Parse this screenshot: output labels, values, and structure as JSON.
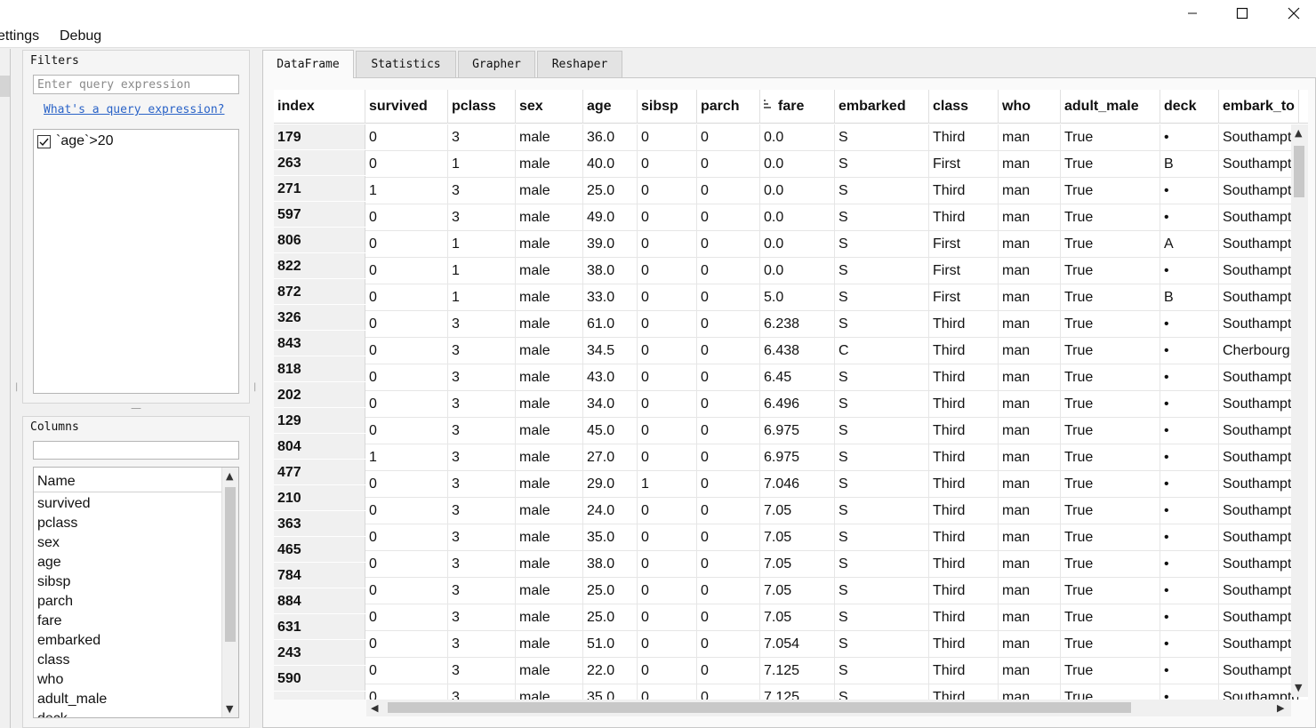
{
  "menu": {
    "settings": "ettings",
    "debug": "Debug"
  },
  "filters": {
    "title": "Filters",
    "placeholder": "Enter query expression",
    "help_link": "What's a query expression?",
    "items": [
      {
        "label": "`age`>20",
        "checked": true
      }
    ]
  },
  "columns_panel": {
    "title": "Columns",
    "header": "Name",
    "names": [
      "survived",
      "pclass",
      "sex",
      "age",
      "sibsp",
      "parch",
      "fare",
      "embarked",
      "class",
      "who",
      "adult_male",
      "deck"
    ]
  },
  "tabs": [
    "DataFrame",
    "Statistics",
    "Grapher",
    "Reshaper"
  ],
  "active_tab": "DataFrame",
  "table": {
    "index_header": "index",
    "headers": [
      "survived",
      "pclass",
      "sex",
      "age",
      "sibsp",
      "parch",
      "fare",
      "embarked",
      "class",
      "who",
      "adult_male",
      "deck",
      "embark_to"
    ],
    "sorted_column": "fare",
    "index": [
      "179",
      "263",
      "271",
      "597",
      "806",
      "822",
      "872",
      "326",
      "843",
      "818",
      "202",
      "129",
      "804",
      "477",
      "210",
      "363",
      "465",
      "784",
      "884",
      "631",
      "243",
      "590",
      ""
    ],
    "rows": [
      [
        "0",
        "3",
        "male",
        "36.0",
        "0",
        "0",
        "0.0",
        "S",
        "Third",
        "man",
        "True",
        "•",
        "Southampton"
      ],
      [
        "0",
        "1",
        "male",
        "40.0",
        "0",
        "0",
        "0.0",
        "S",
        "First",
        "man",
        "True",
        "B",
        "Southampton"
      ],
      [
        "1",
        "3",
        "male",
        "25.0",
        "0",
        "0",
        "0.0",
        "S",
        "Third",
        "man",
        "True",
        "•",
        "Southampton"
      ],
      [
        "0",
        "3",
        "male",
        "49.0",
        "0",
        "0",
        "0.0",
        "S",
        "Third",
        "man",
        "True",
        "•",
        "Southampton"
      ],
      [
        "0",
        "1",
        "male",
        "39.0",
        "0",
        "0",
        "0.0",
        "S",
        "First",
        "man",
        "True",
        "A",
        "Southampton"
      ],
      [
        "0",
        "1",
        "male",
        "38.0",
        "0",
        "0",
        "0.0",
        "S",
        "First",
        "man",
        "True",
        "•",
        "Southampton"
      ],
      [
        "0",
        "1",
        "male",
        "33.0",
        "0",
        "0",
        "5.0",
        "S",
        "First",
        "man",
        "True",
        "B",
        "Southampton"
      ],
      [
        "0",
        "3",
        "male",
        "61.0",
        "0",
        "0",
        "6.238",
        "S",
        "Third",
        "man",
        "True",
        "•",
        "Southampton"
      ],
      [
        "0",
        "3",
        "male",
        "34.5",
        "0",
        "0",
        "6.438",
        "C",
        "Third",
        "man",
        "True",
        "•",
        "Cherbourg"
      ],
      [
        "0",
        "3",
        "male",
        "43.0",
        "0",
        "0",
        "6.45",
        "S",
        "Third",
        "man",
        "True",
        "•",
        "Southampton"
      ],
      [
        "0",
        "3",
        "male",
        "34.0",
        "0",
        "0",
        "6.496",
        "S",
        "Third",
        "man",
        "True",
        "•",
        "Southampton"
      ],
      [
        "0",
        "3",
        "male",
        "45.0",
        "0",
        "0",
        "6.975",
        "S",
        "Third",
        "man",
        "True",
        "•",
        "Southampton"
      ],
      [
        "1",
        "3",
        "male",
        "27.0",
        "0",
        "0",
        "6.975",
        "S",
        "Third",
        "man",
        "True",
        "•",
        "Southampton"
      ],
      [
        "0",
        "3",
        "male",
        "29.0",
        "1",
        "0",
        "7.046",
        "S",
        "Third",
        "man",
        "True",
        "•",
        "Southampton"
      ],
      [
        "0",
        "3",
        "male",
        "24.0",
        "0",
        "0",
        "7.05",
        "S",
        "Third",
        "man",
        "True",
        "•",
        "Southampton"
      ],
      [
        "0",
        "3",
        "male",
        "35.0",
        "0",
        "0",
        "7.05",
        "S",
        "Third",
        "man",
        "True",
        "•",
        "Southampton"
      ],
      [
        "0",
        "3",
        "male",
        "38.0",
        "0",
        "0",
        "7.05",
        "S",
        "Third",
        "man",
        "True",
        "•",
        "Southampton"
      ],
      [
        "0",
        "3",
        "male",
        "25.0",
        "0",
        "0",
        "7.05",
        "S",
        "Third",
        "man",
        "True",
        "•",
        "Southampton"
      ],
      [
        "0",
        "3",
        "male",
        "25.0",
        "0",
        "0",
        "7.05",
        "S",
        "Third",
        "man",
        "True",
        "•",
        "Southampton"
      ],
      [
        "0",
        "3",
        "male",
        "51.0",
        "0",
        "0",
        "7.054",
        "S",
        "Third",
        "man",
        "True",
        "•",
        "Southampton"
      ],
      [
        "0",
        "3",
        "male",
        "22.0",
        "0",
        "0",
        "7.125",
        "S",
        "Third",
        "man",
        "True",
        "•",
        "Southampton"
      ],
      [
        "0",
        "3",
        "male",
        "35.0",
        "0",
        "0",
        "7.125",
        "S",
        "Third",
        "man",
        "True",
        "•",
        "Southampton"
      ]
    ]
  }
}
